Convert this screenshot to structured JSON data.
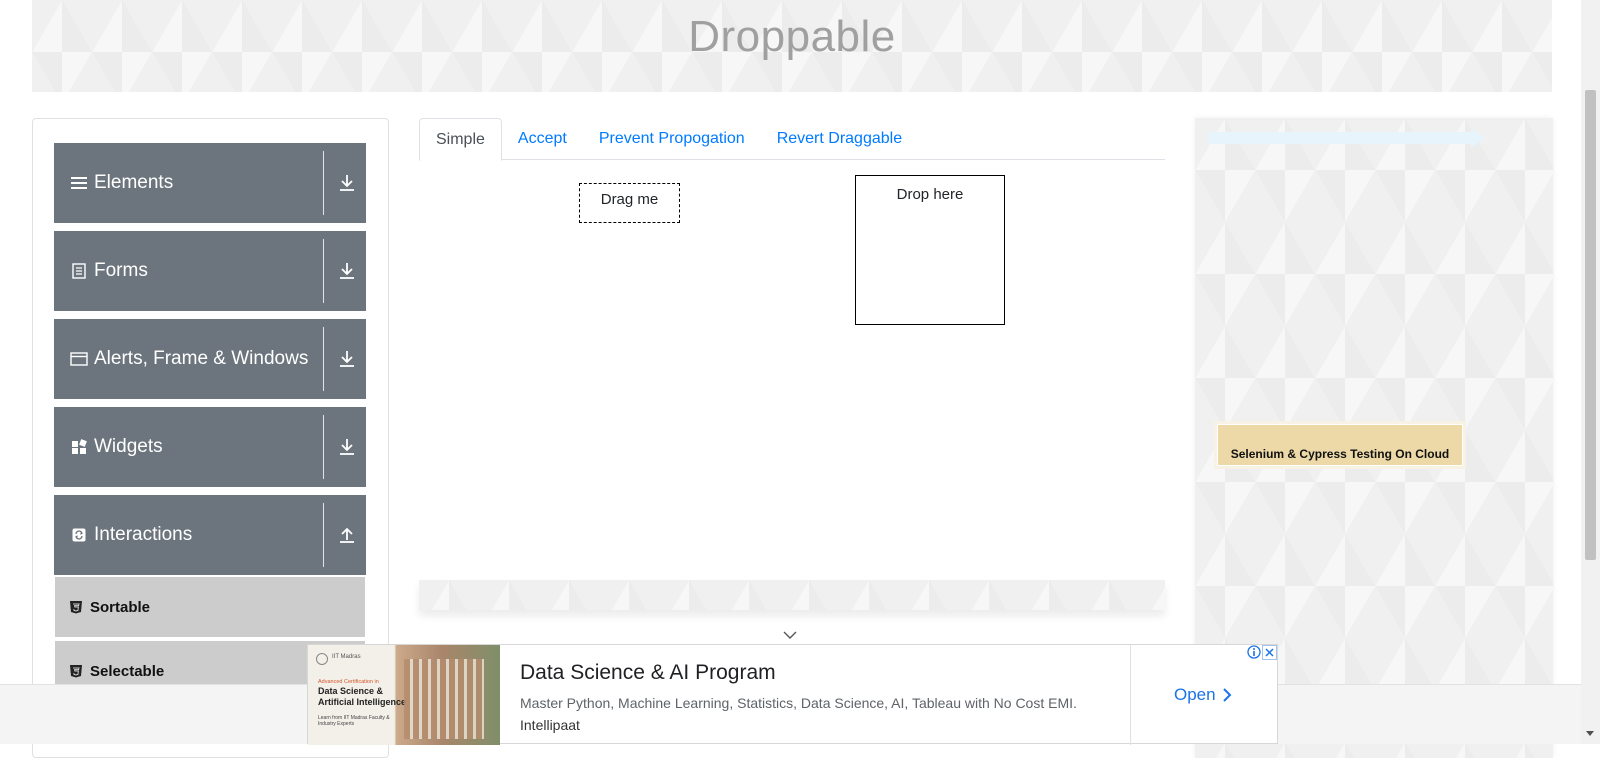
{
  "header": {
    "title": "Droppable"
  },
  "sidebar": {
    "groups": [
      {
        "label": "Elements",
        "icon": "hamburger-icon",
        "state": "collapsed"
      },
      {
        "label": "Forms",
        "icon": "document-icon",
        "state": "collapsed"
      },
      {
        "label": "Alerts, Frame & Windows",
        "icon": "window-icon",
        "state": "collapsed"
      },
      {
        "label": "Widgets",
        "icon": "widgets-icon",
        "state": "collapsed"
      },
      {
        "label": "Interactions",
        "icon": "refresh-icon",
        "state": "expanded"
      }
    ],
    "subitems": [
      {
        "label": "Sortable",
        "icon": "html5-icon"
      },
      {
        "label": "Selectable",
        "icon": "html5-icon"
      }
    ]
  },
  "tabs": [
    {
      "label": "Simple",
      "active": true
    },
    {
      "label": "Accept",
      "active": false
    },
    {
      "label": "Prevent Propogation",
      "active": false
    },
    {
      "label": "Revert Draggable",
      "active": false
    }
  ],
  "draggable": {
    "label": "Drag me"
  },
  "droppable": {
    "label": "Drop here"
  },
  "side_ad": {
    "text": "Selenium & Cypress Testing On Cloud"
  },
  "ad_banner": {
    "thumb_brand": "IIT Madras",
    "thumb_small": "Advanced Certification in",
    "thumb_heading": "Data Science & Artificial Intelligence",
    "thumb_sub": "Learn from IIT Madras Faculty & Industry Experts",
    "headline": "Data Science & AI Program",
    "description": "Master Python, Machine Learning, Statistics, Data Science, AI, Tableau with No Cost EMI.",
    "brand": "Intellipaat",
    "cta": "Open"
  },
  "colors": {
    "sidebar_group_bg": "#6c757d",
    "sidebar_subitem_bg": "#cccccc",
    "link_blue": "#007bff",
    "ad_cta_blue": "#1a73e8",
    "header_title": "#a0a0a0"
  }
}
